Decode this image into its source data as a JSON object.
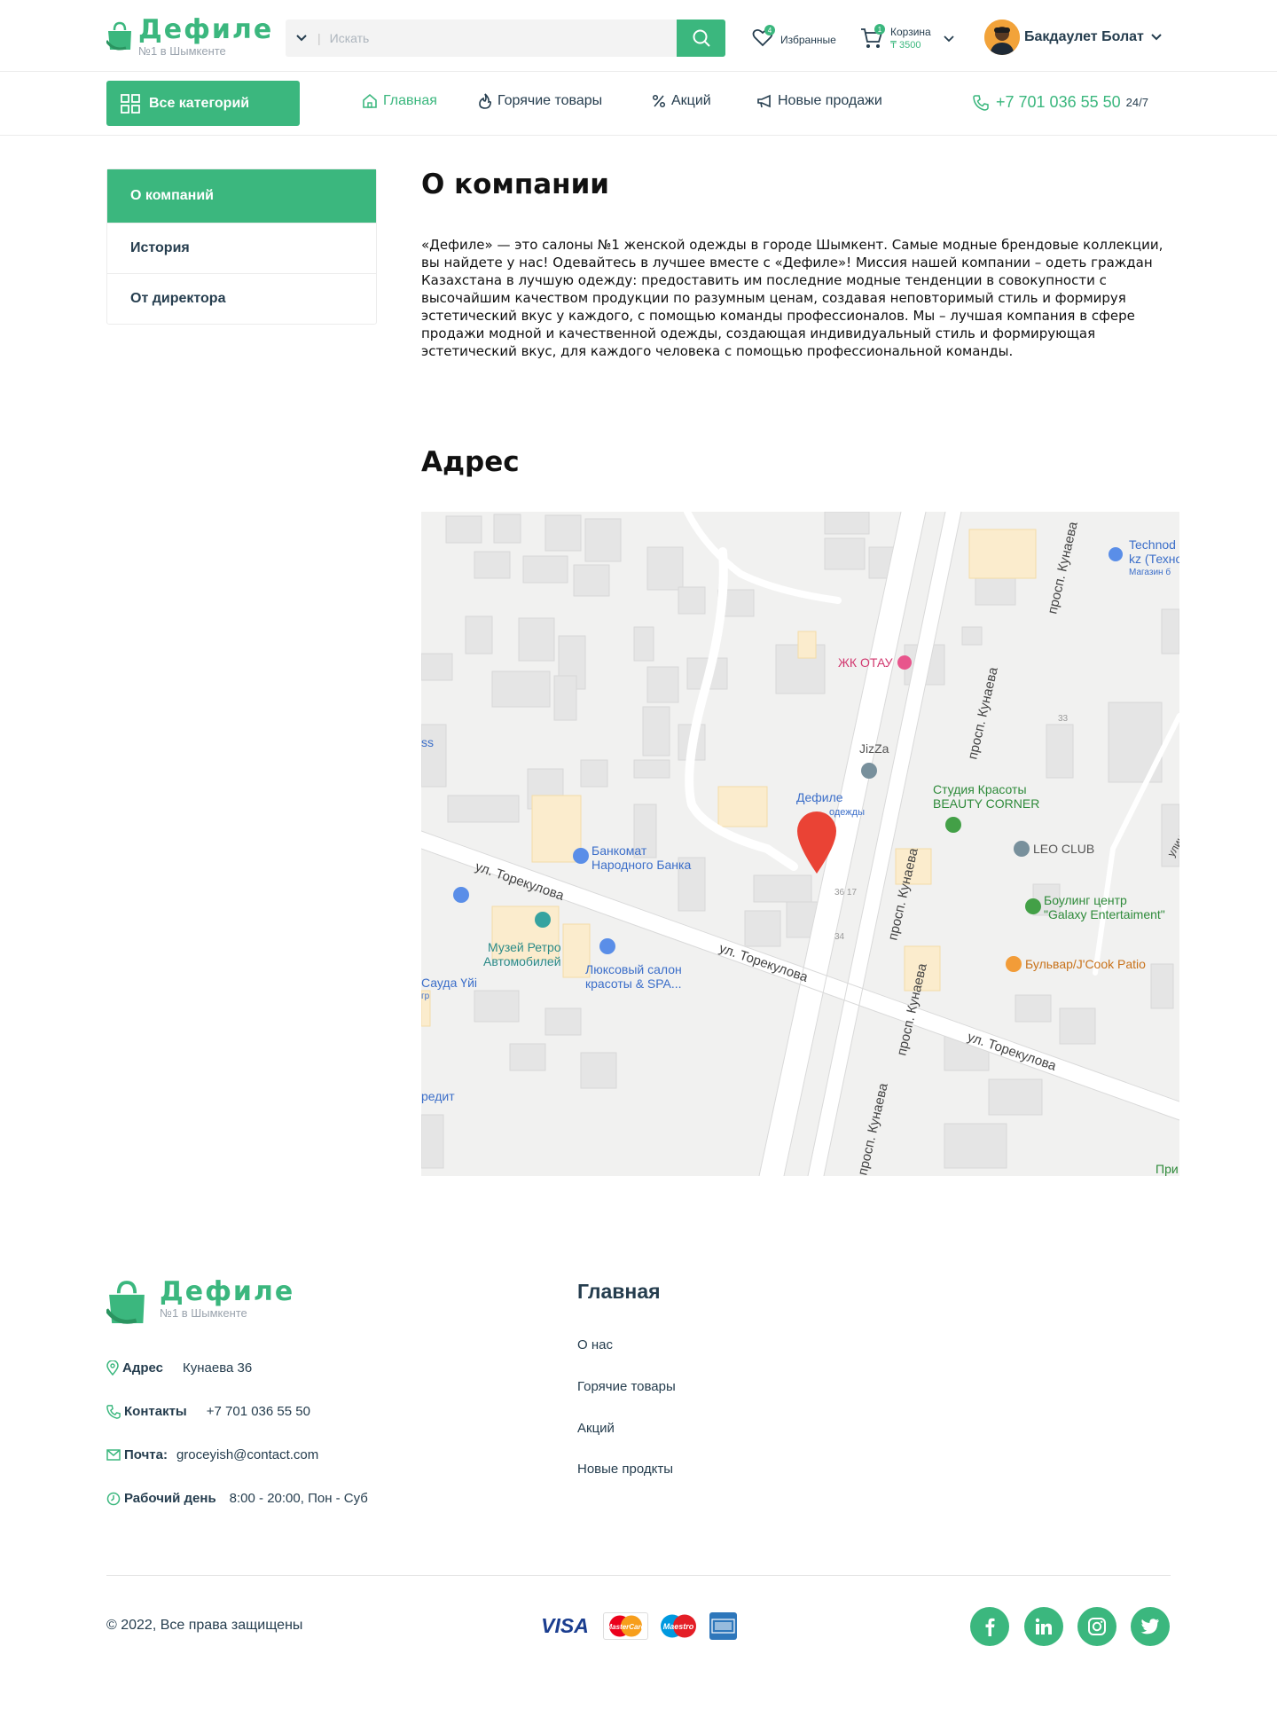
{
  "header": {
    "logo_title": "Дефиле",
    "logo_subtitle": "№1 в Шымкенте",
    "search_placeholder": "Искать",
    "favorites_label": "Избранные",
    "favorites_count": "4",
    "cart_label": "Корзина",
    "cart_total": "₸ 3500",
    "cart_count": "1",
    "user_name": "Бакдаулет Болат"
  },
  "nav": {
    "all_categories": "Все категорий",
    "items": [
      "Главная",
      "Горячие товары",
      "Акций",
      "Новые продажи"
    ],
    "phone": "+7 701 036 55 50",
    "hours": "24/7"
  },
  "sidebar": {
    "items": [
      "О компаний",
      "История",
      "От директора"
    ]
  },
  "main": {
    "title": "О компании",
    "about": "«Дефиле» — это салоны №1 женской одежды в городе Шымкент. Самые модные брендовые коллекции, вы найдете у нас! Одевайтесь в лучшее вместе с «Дефиле»! Миссия нашей компании – одеть граждан Казахстана в лучшую одежду: предоставить им последние модные тенденции в совокупности с высочайшим качеством продукции по разумным ценам, создавая неповторимый стиль и формируя эстетический вкус у каждого, с помощью команды профессионалов. Мы – лучшая компания в сфере продажи модной и качественной одежды, создающая индивидуальный стиль и формирующая эстетический вкус, для каждого человека с помощью профессиональной команды.",
    "address_title": "Адрес"
  },
  "map": {
    "labels": {
      "technodom": "Technod",
      "technodom2": "kz (Техно",
      "technodom3": "Магазин б",
      "otau": "ЖК ОТАУ",
      "jizza": "JizZa",
      "defile1": "Дефиле",
      "defile2": "одежды",
      "beauty1": "Студия Красоты",
      "beauty2": "BEAUTY CORNER",
      "leo": "LEO CLUB",
      "bowling1": "Боулинг центр",
      "bowling2": "\"Galaxy Entertaiment\"",
      "bulvar": "Бульвар/J'Cook Patio",
      "bank1": "Банкомат",
      "bank2": "Народного Банка",
      "museum1": "Музей Ретро",
      "museum2": "Автомобилей",
      "salon1": "Люксовый салон",
      "salon2": "красоты & SPA...",
      "sauda": "Сауда Үйі",
      "ss": "ss",
      "gr": "гр",
      "kredit": "редит",
      "pri": "При",
      "torekulova": "ул. Торекулова",
      "kunaeva": "просп. Кунаева",
      "street_k": "улица Ку",
      "n33": "33",
      "n3617": "36 17",
      "n34": "34"
    }
  },
  "footer": {
    "logo_title": "Дефиле",
    "logo_subtitle": "№1 в Шымкенте",
    "address_label": "Адрес",
    "address_value": "Кунаева 36",
    "contacts_label": "Контакты",
    "contacts_value": "+7 701 036 55 50",
    "mail_label": "Почта:",
    "mail_value": "groceyish@contact.com",
    "work_label": "Рабочий день",
    "work_value": "8:00 - 20:00, Пон -  Суб",
    "menu_title": "Главная",
    "links": [
      "О нас",
      "Горячие товары",
      "Акций",
      "Новые продкты"
    ],
    "copyright": "© 2022, Все права защищены",
    "payments": {
      "visa": "VISA",
      "mastercard": "MasterCard",
      "maestro": "Maestro"
    }
  },
  "colors": {
    "accent": "#3bb77e",
    "text": "#253d4e",
    "map_pin": "#ea4335"
  }
}
